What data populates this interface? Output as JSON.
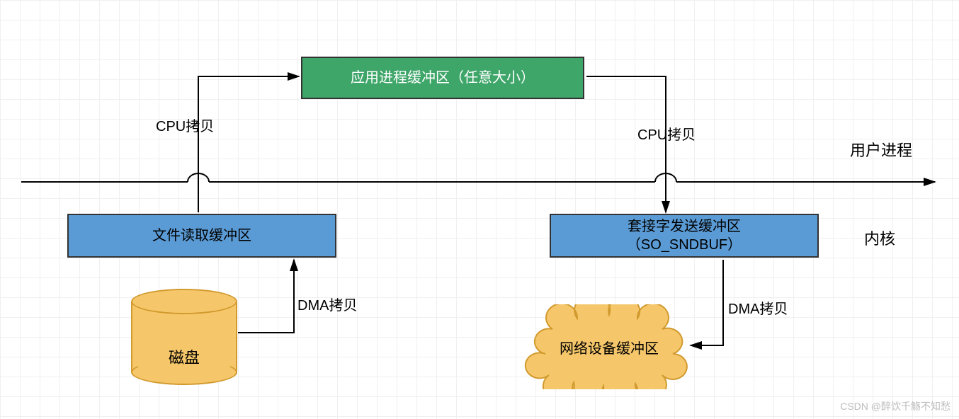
{
  "boxes": {
    "app_buffer": "应用进程缓冲区（任意大小）",
    "file_read_buffer": "文件读取缓冲区",
    "socket_send_buffer_line1": "套接字发送缓冲区",
    "socket_send_buffer_line2": "（SO_SNDBUF）"
  },
  "shapes": {
    "disk": "磁盘",
    "network_cloud": "网络设备缓冲区"
  },
  "labels": {
    "cpu_copy_left": "CPU拷贝",
    "cpu_copy_right": "CPU拷贝",
    "dma_copy_left": "DMA拷贝",
    "dma_copy_right": "DMA拷贝",
    "user_process": "用户进程",
    "kernel": "内核"
  },
  "watermark": "CSDN @醉饮千觞不知愁",
  "colors": {
    "green": "#3fa66a",
    "blue": "#5b9bd5",
    "sand": "#f6c76a",
    "sand_border": "#d19a2e",
    "line": "#000000"
  }
}
